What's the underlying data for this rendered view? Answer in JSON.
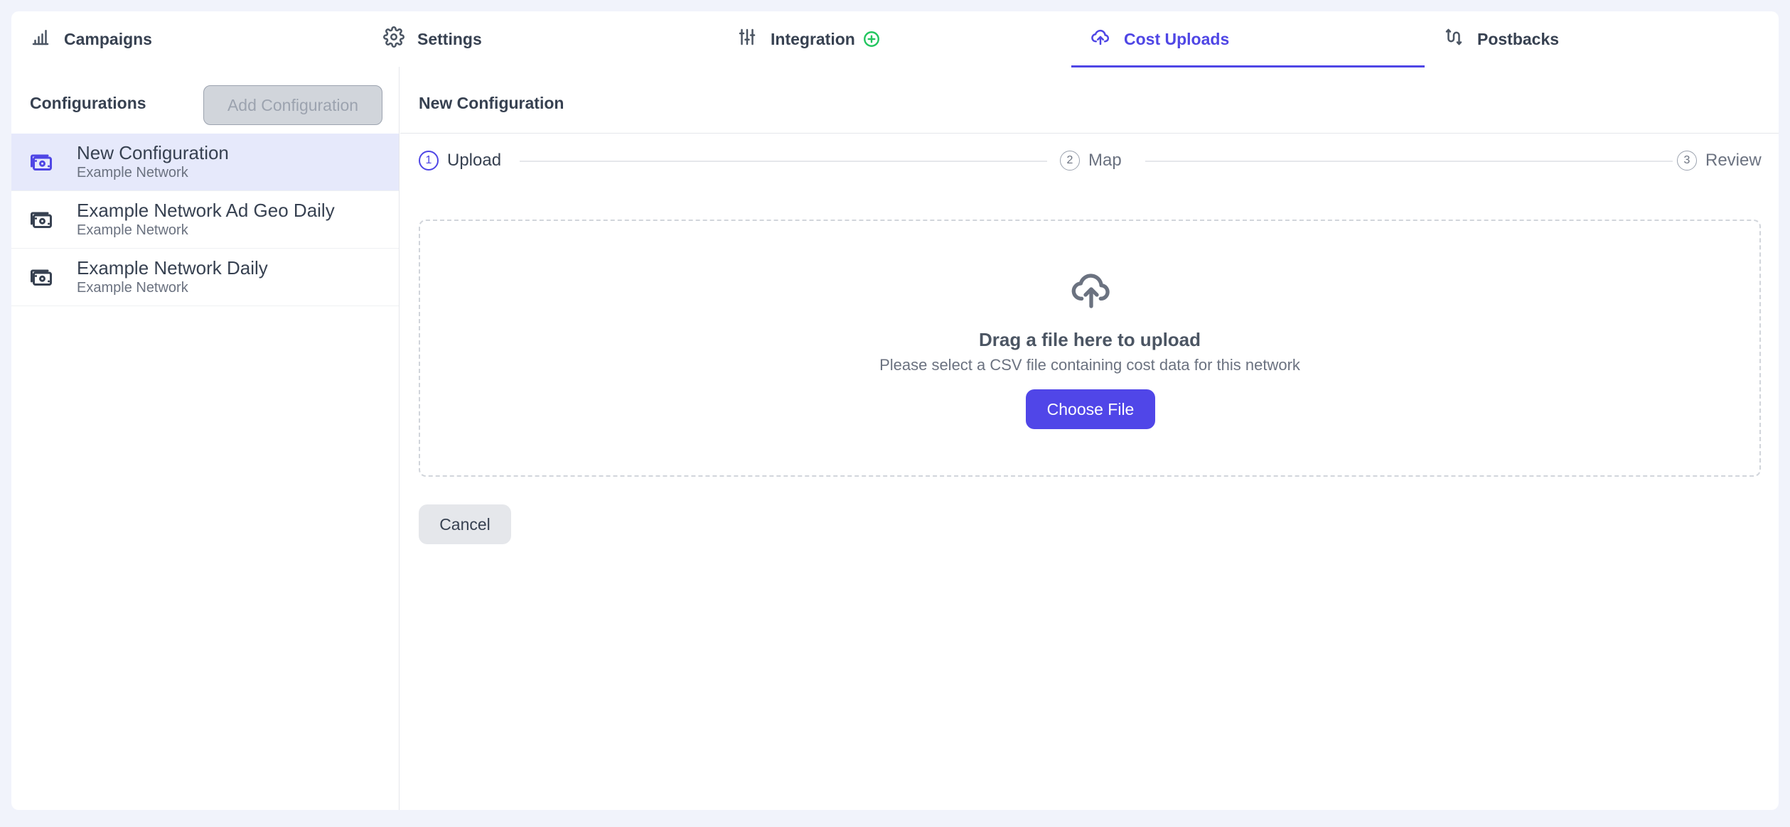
{
  "tabs": [
    {
      "label": "Campaigns",
      "icon": "bar-chart-icon"
    },
    {
      "label": "Settings",
      "icon": "gear-icon"
    },
    {
      "label": "Integration",
      "icon": "sliders-icon",
      "badge_icon": "plus-circle-icon"
    },
    {
      "label": "Cost Uploads",
      "icon": "cloud-upload-icon",
      "active": true
    },
    {
      "label": "Postbacks",
      "icon": "route-icon"
    }
  ],
  "sidebar": {
    "title": "Configurations",
    "add_button_label": "Add Configuration",
    "items": [
      {
        "name": "New Configuration",
        "network": "Example Network",
        "selected": true,
        "icon": "money-stack-icon"
      },
      {
        "name": "Example Network Ad Geo Daily",
        "network": "Example Network",
        "icon": "money-stack-icon"
      },
      {
        "name": "Example Network Daily",
        "network": "Example Network",
        "icon": "money-stack-icon"
      }
    ]
  },
  "main": {
    "title": "New Configuration",
    "steps": [
      {
        "num": "1",
        "label": "Upload",
        "active": true
      },
      {
        "num": "2",
        "label": "Map"
      },
      {
        "num": "3",
        "label": "Review"
      }
    ],
    "dropzone": {
      "icon": "cloud-upload-icon",
      "title": "Drag a file here to upload",
      "subtitle": "Please select a CSV file containing cost data for this network",
      "button_label": "Choose File"
    },
    "cancel_label": "Cancel"
  },
  "colors": {
    "accent": "#4f46e5",
    "success": "#22c55e",
    "selected_row": "#e6e9fb",
    "page_bg": "#f1f3fb"
  }
}
